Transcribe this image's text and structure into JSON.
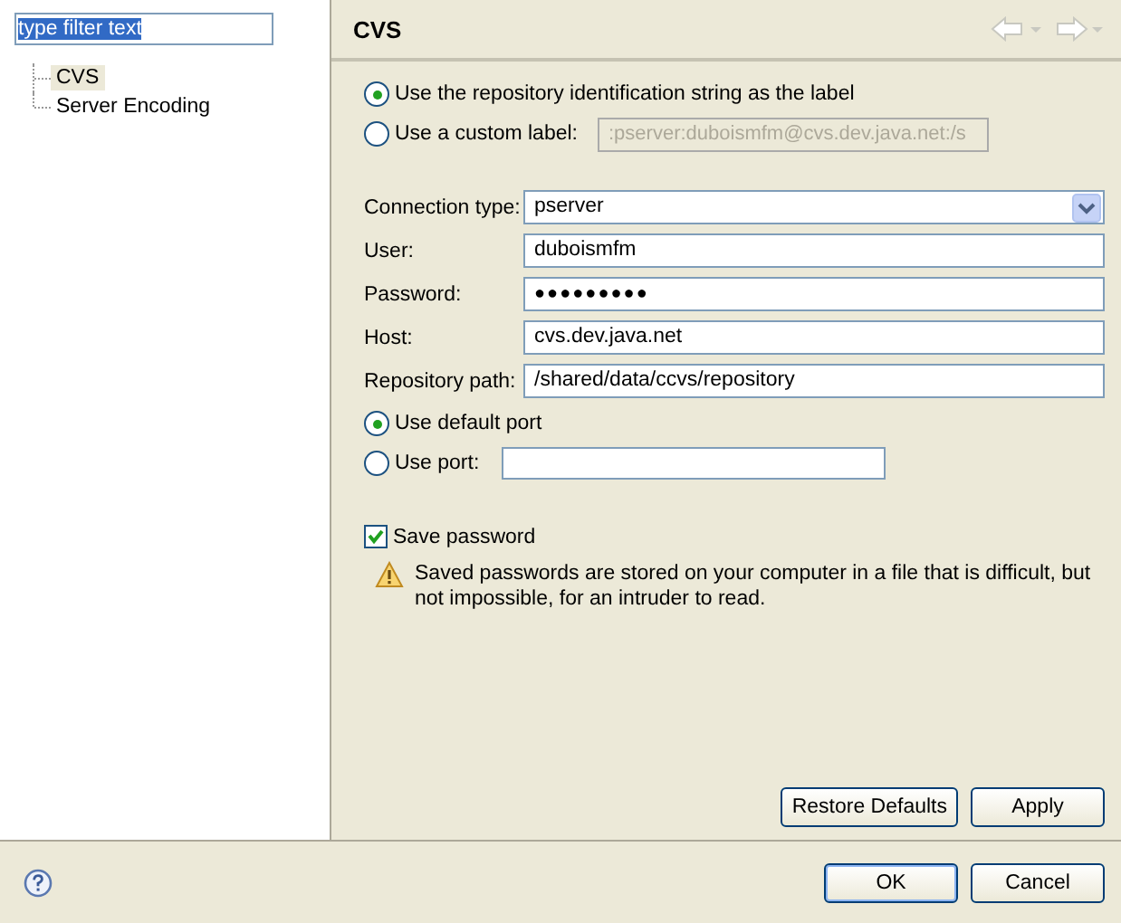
{
  "filter": {
    "value": "type filter text"
  },
  "tree": [
    {
      "label": "CVS",
      "selected": true
    },
    {
      "label": "Server Encoding",
      "selected": false
    }
  ],
  "page": {
    "title": "CVS"
  },
  "label_options": [
    {
      "label": "Use the repository identification string as the label",
      "selected": true
    },
    {
      "label": "Use a custom label:",
      "selected": false,
      "field": {
        "value": ":pserver:duboismfm@cvs.dev.java.net:/s",
        "disabled": true
      }
    }
  ],
  "fields": [
    {
      "label": "Connection type:",
      "kind": "dropdown",
      "value": "pserver"
    },
    {
      "label": "User:",
      "kind": "text",
      "value": "duboismfm"
    },
    {
      "label": "Password:",
      "kind": "password",
      "value": "●●●●●●●●●"
    },
    {
      "label": "Host:",
      "kind": "text",
      "value": "cvs.dev.java.net"
    },
    {
      "label": "Repository path:",
      "kind": "text",
      "value": "/shared/data/ccvs/repository"
    }
  ],
  "port_options": [
    {
      "label": "Use default port",
      "selected": true
    },
    {
      "label": "Use port:",
      "selected": false,
      "field": {
        "disabled": false
      }
    }
  ],
  "save_password": {
    "label": "Save password",
    "checked": true
  },
  "warning": "Saved passwords are stored on your computer in a file that is difficult, but not impossible, for an intruder to read.",
  "page_buttons": [
    "Restore Defaults",
    "Apply"
  ],
  "dialog_buttons": [
    {
      "label": "OK",
      "default": true
    },
    {
      "label": "Cancel",
      "default": false
    }
  ]
}
